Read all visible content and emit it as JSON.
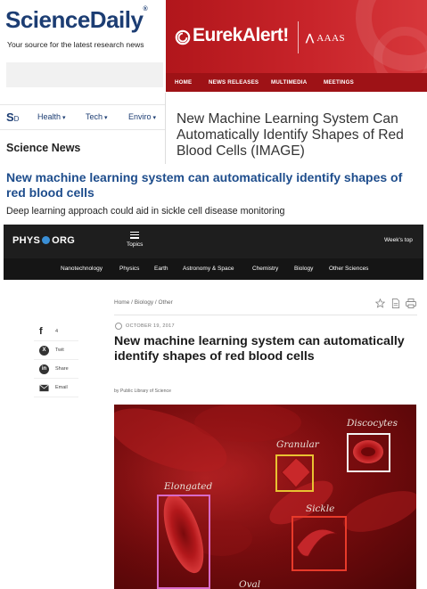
{
  "sciencedaily": {
    "logo_part1": "Science",
    "logo_part2": "Daily",
    "logo_mark": "®",
    "tagline": "Your source for the latest research news",
    "nav": {
      "mark": "S",
      "mark_sub": "D",
      "items": [
        "Health",
        "Tech",
        "Enviro"
      ]
    },
    "section": "Science News",
    "headline": "New machine learning system can automatically identify shapes of red blood cells",
    "subheadline": "Deep learning approach could aid in sickle cell disease monitoring"
  },
  "eurekalert": {
    "logo": "EurekAlert!",
    "partner": "AAAS",
    "nav": [
      "HOME",
      "NEWS RELEASES",
      "MULTIMEDIA",
      "MEETINGS"
    ],
    "title": "New Machine Learning System Can Automatically Identify Shapes of Red Blood Cells (IMAGE)"
  },
  "physorg": {
    "logo_part1": "PHYS",
    "logo_part2": "ORG",
    "menu_label": "Topics",
    "week_top": "Week's top",
    "subnav": [
      "Nanotechnology",
      "Physics",
      "Earth",
      "Astronomy & Space",
      "Chemistry",
      "Biology",
      "Other Sciences"
    ],
    "share": [
      {
        "label": "4",
        "icon": "facebook-icon"
      },
      {
        "label": "Twit",
        "icon": "x-icon"
      },
      {
        "label": "Share",
        "icon": "linkedin-icon"
      },
      {
        "label": "Email",
        "icon": "email-icon"
      }
    ],
    "breadcrumb": "Home / Biology / Other",
    "date": "OCTOBER 19, 2017",
    "title": "New machine learning system can automatically identify shapes of red blood cells",
    "byline": "by Public Library of Science",
    "image_labels": {
      "granular": "Granular",
      "discocytes": "Discocytes",
      "elongated": "Elongated",
      "sickle": "Sickle",
      "oval": "Oval"
    },
    "colors": {
      "granular_box": "#e8c232",
      "discocytes_box": "#f2f2f2",
      "elongated_box": "#d86ac8",
      "sickle_box": "#e83a2a"
    }
  }
}
